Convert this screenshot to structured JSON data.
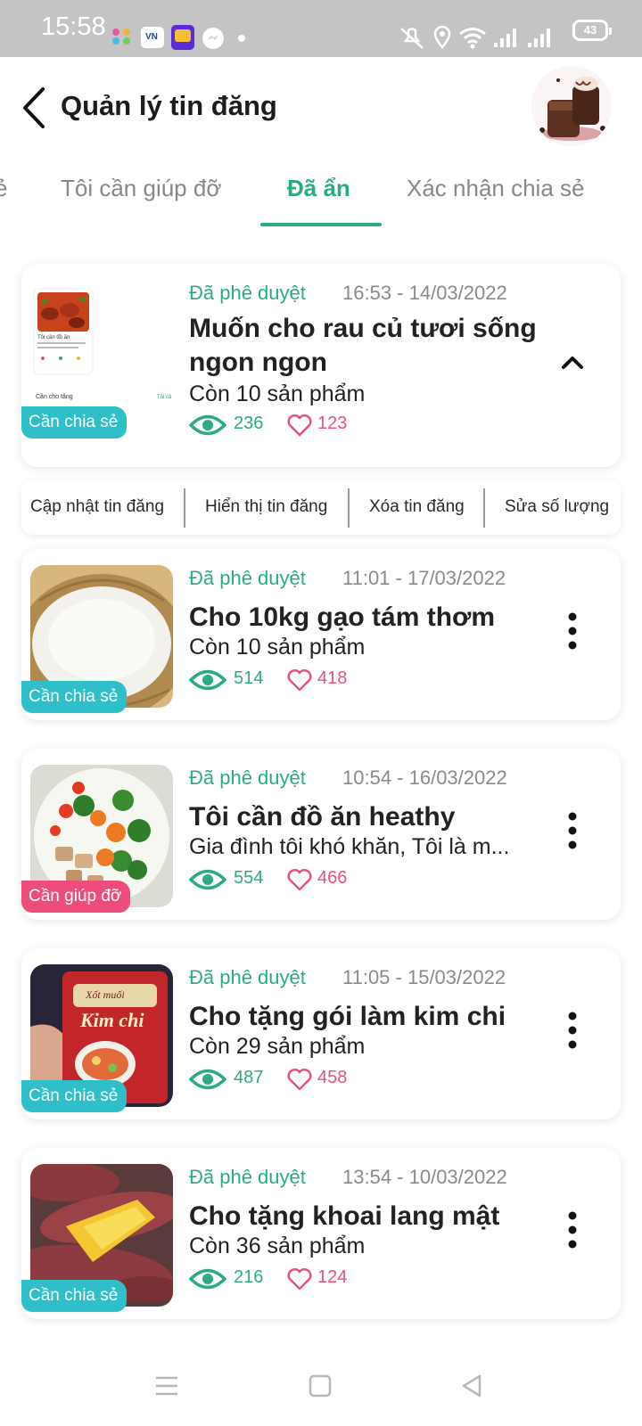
{
  "status_bar": {
    "time": "15:58",
    "battery": "43",
    "left_icons": [
      "app-notification-icon",
      "vn-app-icon",
      "tv-app-icon",
      "messenger-icon",
      "dot-icon"
    ],
    "right_icons": [
      "mute-vibrate-icon",
      "location-icon",
      "wifi-icon",
      "signal-icon",
      "signal-icon"
    ]
  },
  "header": {
    "title": "Quản lý tin đăng",
    "back_icon": "chevron-left-icon",
    "avatar_icon": "chocolate-drink-avatar"
  },
  "tabs": {
    "items": [
      {
        "label": "ẻ"
      },
      {
        "label": "Tôi cần giúp đỡ"
      },
      {
        "label": "Đã ẩn",
        "active": true
      },
      {
        "label": "Xác nhận chia sẻ"
      }
    ]
  },
  "posts": [
    {
      "status": "Đã phê duyệt",
      "date": "16:53 - 14/03/2022",
      "title": "Muốn cho rau củ tươi sống ngon ngon",
      "subtitle": "Còn 10 sản phẩm",
      "views": "236",
      "likes": "123",
      "badge": "Cần chia sẻ",
      "expanded": true,
      "thumb_texts": [
        "Tôi cần đồ ăn",
        "Gia đình tôi khó khăn. Tôi không đủ sức để lo đồ ăn cho...",
        "Cần cho tặng",
        "Tôi cả"
      ]
    },
    {
      "status": "Đã phê duyệt",
      "date": "11:01 - 17/03/2022",
      "title": "Cho 10kg gạo tám thơm",
      "subtitle": "Còn 10 sản phẩm",
      "views": "514",
      "likes": "418",
      "badge": "Cần chia sẻ"
    },
    {
      "status": "Đã phê duyệt",
      "date": "10:54 - 16/03/2022",
      "title": "Tôi cần đồ ăn heathy",
      "subtitle": "Gia đình tôi khó khăn, Tôi là m...",
      "views": "554",
      "likes": "466",
      "badge": "Cần giúp đỡ"
    },
    {
      "status": "Đã phê duyệt",
      "date": "11:05 - 15/03/2022",
      "title": "Cho tặng gói làm kim chi",
      "subtitle": "Còn 29 sản phẩm",
      "views": "487",
      "likes": "458",
      "badge": "Cần chia sẻ",
      "thumb_texts": [
        "Xốt muối",
        "Kim chi"
      ]
    },
    {
      "status": "Đã phê duyệt",
      "date": "13:54 - 10/03/2022",
      "title": "Cho tặng khoai lang mật",
      "subtitle": "Còn 36 sản phẩm",
      "views": "216",
      "likes": "124",
      "badge": "Cần chia sẻ"
    }
  ],
  "actions": {
    "update": "Cập nhật tin đăng",
    "show": "Hiển thị tin đăng",
    "delete": "Xóa tin đăng",
    "edit_quantity": "Sửa số lượng"
  },
  "colors": {
    "accent": "#2bab84",
    "likes": "#e9507a",
    "badge_share": "#2ebfc8",
    "badge_help": "#ee4c7a",
    "status_bar": "#c4c4c4"
  },
  "nav_bar": {
    "icons": [
      "recent-apps-icon",
      "home-icon",
      "back-triangle-icon"
    ]
  }
}
